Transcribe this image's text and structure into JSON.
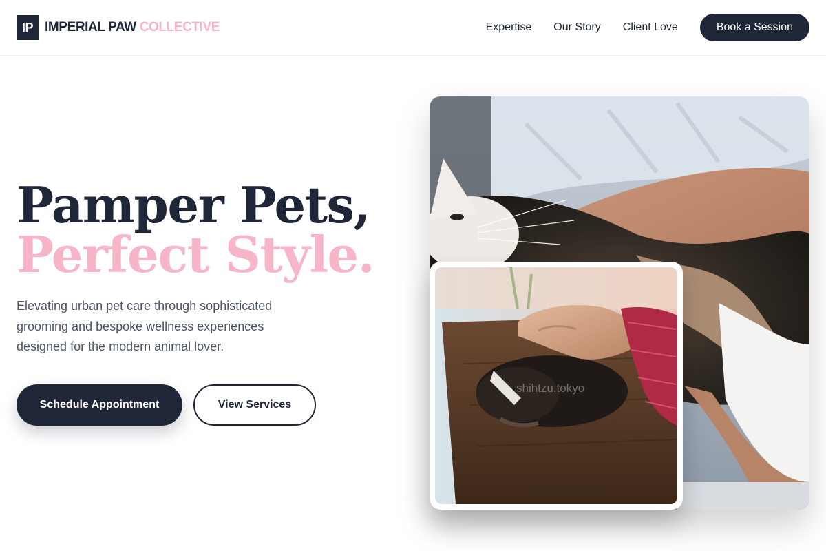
{
  "brand": {
    "mark": "IP",
    "name": "IMPERIAL PAW",
    "name_accent": "COLLECTIVE"
  },
  "nav": {
    "links": [
      "Expertise",
      "Our Story",
      "Client Love"
    ],
    "cta": "Book a Session"
  },
  "hero": {
    "title_line1": "Pamper Pets,",
    "title_line2": "Perfect Style.",
    "subtitle": "Elevating urban pet care through sophisticated grooming and bespoke wellness experiences designed for the modern animal lover.",
    "primary_button": "Schedule Appointment",
    "secondary_button": "View Services"
  },
  "images": {
    "main": "cat-photo",
    "inset": "puppy-photo",
    "watermark": "shihtzu.tokyo"
  },
  "colors": {
    "navy": "#1e2638",
    "pink": "#f7b6c8",
    "text_muted": "#4c5567"
  }
}
